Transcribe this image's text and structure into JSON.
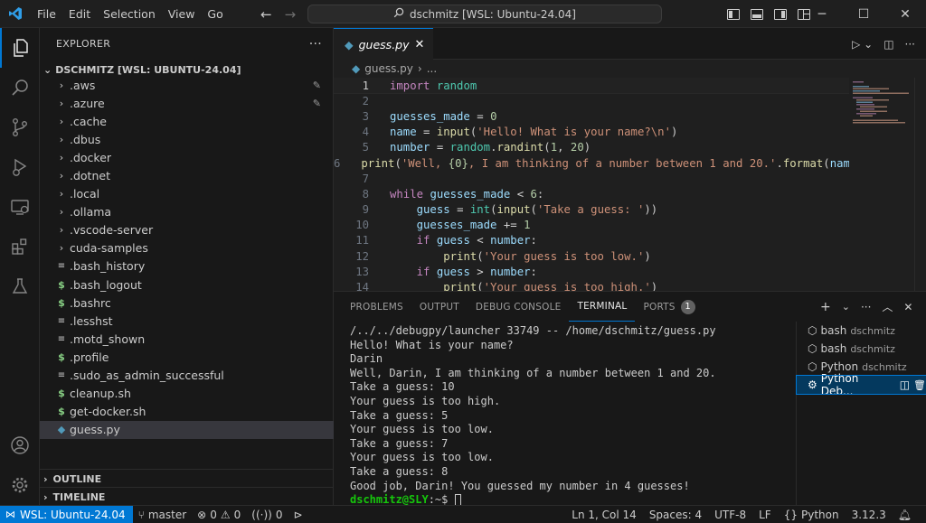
{
  "menu": [
    "File",
    "Edit",
    "Selection",
    "View",
    "Go"
  ],
  "command_center": "dschmitz [WSL: Ubuntu-24.04]",
  "sidebar": {
    "title": "EXPLORER",
    "root": "DSCHMITZ [WSL: UBUNTU-24.04]",
    "items": [
      {
        "label": ".aws",
        "type": "folder",
        "modified": true
      },
      {
        "label": ".azure",
        "type": "folder",
        "modified": true
      },
      {
        "label": ".cache",
        "type": "folder"
      },
      {
        "label": ".dbus",
        "type": "folder"
      },
      {
        "label": ".docker",
        "type": "folder"
      },
      {
        "label": ".dotnet",
        "type": "folder"
      },
      {
        "label": ".local",
        "type": "folder"
      },
      {
        "label": ".ollama",
        "type": "folder"
      },
      {
        "label": ".vscode-server",
        "type": "folder"
      },
      {
        "label": "cuda-samples",
        "type": "folder"
      },
      {
        "label": ".bash_history",
        "type": "text"
      },
      {
        "label": ".bash_logout",
        "type": "shell"
      },
      {
        "label": ".bashrc",
        "type": "shell"
      },
      {
        "label": ".lesshst",
        "type": "text"
      },
      {
        "label": ".motd_shown",
        "type": "text"
      },
      {
        "label": ".profile",
        "type": "shell"
      },
      {
        "label": ".sudo_as_admin_successful",
        "type": "text"
      },
      {
        "label": "cleanup.sh",
        "type": "shell"
      },
      {
        "label": "get-docker.sh",
        "type": "shell"
      },
      {
        "label": "guess.py",
        "type": "python",
        "selected": true
      }
    ],
    "outline": "OUTLINE",
    "timeline": "TIMELINE"
  },
  "editor": {
    "tab": "guess.py",
    "breadcrumb_file": "guess.py",
    "breadcrumb_more": "...",
    "line_numbers": [
      "1",
      "2",
      "3",
      "4",
      "5",
      "6",
      "7",
      "8",
      "9",
      "10",
      "11",
      "12",
      "13",
      "14"
    ]
  },
  "panel": {
    "tabs": [
      "PROBLEMS",
      "OUTPUT",
      "DEBUG CONSOLE",
      "TERMINAL",
      "PORTS"
    ],
    "ports_badge": "1",
    "terminal_lines": [
      "/../../debugpy/launcher 33749 -- /home/dschmitz/guess.py",
      "Hello! What is your name?",
      "Darin",
      "Well, Darin, I am thinking of a number between 1 and 20.",
      "Take a guess: 10",
      "Your guess is too high.",
      "Take a guess: 5",
      "Your guess is too low.",
      "Take a guess: 7",
      "Your guess is too low.",
      "Take a guess: 8",
      "Good job, Darin! You guessed my number in 4 guesses!"
    ],
    "prompt_user": "dschmitz@SLY",
    "prompt_rest": ":~$ ",
    "terminals": [
      {
        "name": "bash",
        "sub": "dschmitz"
      },
      {
        "name": "bash",
        "sub": "dschmitz"
      },
      {
        "name": "Python",
        "sub": "dschmitz"
      },
      {
        "name": "Python Deb...",
        "sub": ""
      }
    ]
  },
  "status": {
    "remote": "WSL: Ubuntu-24.04",
    "branch": "master",
    "errors": "0",
    "warnings": "0",
    "ports": "0",
    "position": "Ln 1, Col 14",
    "spaces": "Spaces: 4",
    "encoding": "UTF-8",
    "eol": "LF",
    "language": "Python",
    "version": "3.12.3"
  },
  "colors": {
    "accent": "#0078d4",
    "keyword": "#c586c0",
    "string": "#ce9178",
    "function": "#dcdcaa",
    "number": "#b5cea8",
    "variable": "#9cdcfe"
  }
}
